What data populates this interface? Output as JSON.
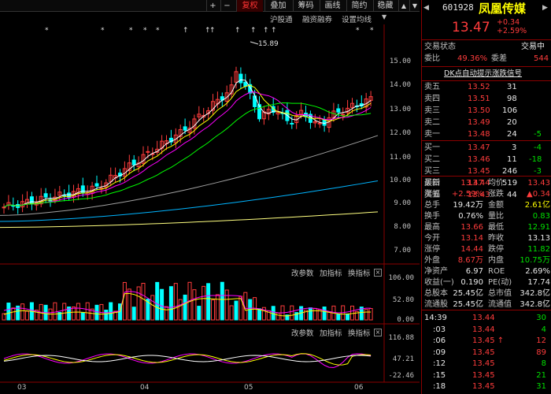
{
  "toolbar": {
    "plus": "+",
    "minus": "−",
    "buttons": [
      "复权",
      "叠加",
      "筹码",
      "画线",
      "简约",
      "稳藏"
    ],
    "active_index": 0,
    "nav_up": "▲",
    "nav_down": "▼"
  },
  "subbar": {
    "items": [
      "沪股通",
      "融资融券",
      "设置均线"
    ]
  },
  "main_chart": {
    "y_ticks": [
      "15.00",
      "14.00",
      "13.00",
      "12.00",
      "11.00",
      "10.00",
      "9.00",
      "8.00",
      "7.00"
    ],
    "high_label": "15.89",
    "x_ticks": [
      "03",
      "04",
      "05",
      "06"
    ]
  },
  "volume_panel": {
    "buttons": [
      "改参数",
      "加指标",
      "换指标"
    ],
    "close": "×",
    "y_ticks": [
      "106.00",
      "52.80",
      "0.00"
    ]
  },
  "macd_panel": {
    "buttons": [
      "改参数",
      "加指标",
      "换指标"
    ],
    "close": "×",
    "y_ticks": [
      "116.88",
      "47.21",
      "-22.46"
    ]
  },
  "stock": {
    "code": "601928",
    "name": "凤凰传媒",
    "price": "13.47",
    "change": "+0.34",
    "change_pct": "+2.59%",
    "status_label": "交易状态",
    "status_value": "交易中",
    "ratio_label": "委比",
    "ratio_value": "49.36%",
    "diff_label": "委差",
    "diff_value": "544",
    "dk_signal": "DK点自动提示涨跌信号"
  },
  "asks": [
    {
      "label": "卖五",
      "price": "13.52",
      "vol": "31",
      "chg": ""
    },
    {
      "label": "卖四",
      "price": "13.51",
      "vol": "98",
      "chg": ""
    },
    {
      "label": "卖三",
      "price": "13.50",
      "vol": "106",
      "chg": ""
    },
    {
      "label": "卖二",
      "price": "13.49",
      "vol": "20",
      "chg": ""
    },
    {
      "label": "卖一",
      "price": "13.48",
      "vol": "24",
      "chg": "-5"
    }
  ],
  "bids": [
    {
      "label": "买一",
      "price": "13.47",
      "vol": "3",
      "chg": "-4"
    },
    {
      "label": "买二",
      "price": "13.46",
      "vol": "11",
      "chg": "-18"
    },
    {
      "label": "买三",
      "price": "13.45",
      "vol": "246",
      "chg": "-3"
    },
    {
      "label": "买四",
      "price": "13.44",
      "vol": "519",
      "chg": ""
    },
    {
      "label": "买五",
      "price": "13.43",
      "vol": "44",
      "chg": ""
    }
  ],
  "stats": [
    {
      "l1": "最新",
      "v1": "13.47",
      "c1": "red",
      "l2": "均价",
      "v2": "13.43",
      "c2": "red"
    },
    {
      "l1": "涨幅",
      "v1": "+2.59%",
      "c1": "red",
      "l2": "涨跌",
      "v2": "▲0.34",
      "c2": "red"
    },
    {
      "l1": "总手",
      "v1": "19.42万",
      "c1": "white",
      "l2": "金额",
      "v2": "2.61亿",
      "c2": "yellow"
    },
    {
      "l1": "换手",
      "v1": "0.76%",
      "c1": "white",
      "l2": "量比",
      "v2": "0.83",
      "c2": "green"
    },
    {
      "l1": "最高",
      "v1": "13.66",
      "c1": "red",
      "l2": "最低",
      "v2": "12.91",
      "c2": "green"
    },
    {
      "l1": "今开",
      "v1": "13.14",
      "c1": "red",
      "l2": "昨收",
      "v2": "13.13",
      "c2": "white"
    },
    {
      "l1": "涨停",
      "v1": "14.44",
      "c1": "red",
      "l2": "跌停",
      "v2": "11.82",
      "c2": "green"
    },
    {
      "l1": "外盘",
      "v1": "8.67万",
      "c1": "red",
      "l2": "内盘",
      "v2": "10.75万",
      "c2": "green"
    },
    {
      "l1": "净资产",
      "v1": "6.97",
      "c1": "white",
      "l2": "ROE",
      "v2": "2.69%",
      "c2": "white"
    },
    {
      "l1": "收益(一)",
      "v1": "0.190",
      "c1": "white",
      "l2": "PE(动)",
      "v2": "17.74",
      "c2": "white"
    },
    {
      "l1": "总股本",
      "v1": "25.45亿",
      "c1": "white",
      "l2": "总市值",
      "v2": "342.8亿",
      "c2": "white"
    },
    {
      "l1": "流通股",
      "v1": "25.45亿",
      "c1": "white",
      "l2": "流通值",
      "v2": "342.8亿",
      "c2": "white"
    }
  ],
  "ticks": [
    {
      "time": "14:39",
      "price": "13.44",
      "arrow": "",
      "vol": "30",
      "vc": "green"
    },
    {
      "time": ":03",
      "price": "13.44",
      "arrow": "",
      "vol": "4",
      "vc": "green"
    },
    {
      "time": ":06",
      "price": "13.45",
      "arrow": "↑",
      "vol": "12",
      "vc": "red"
    },
    {
      "time": ":09",
      "price": "13.45",
      "arrow": "",
      "vol": "89",
      "vc": "red"
    },
    {
      "time": ":12",
      "price": "13.45",
      "arrow": "",
      "vol": "8",
      "vc": "green"
    },
    {
      "time": ":15",
      "price": "13.45",
      "arrow": "",
      "vol": "21",
      "vc": "green"
    },
    {
      "time": ":18",
      "price": "13.45",
      "arrow": "",
      "vol": "31",
      "vc": "green"
    }
  ]
}
